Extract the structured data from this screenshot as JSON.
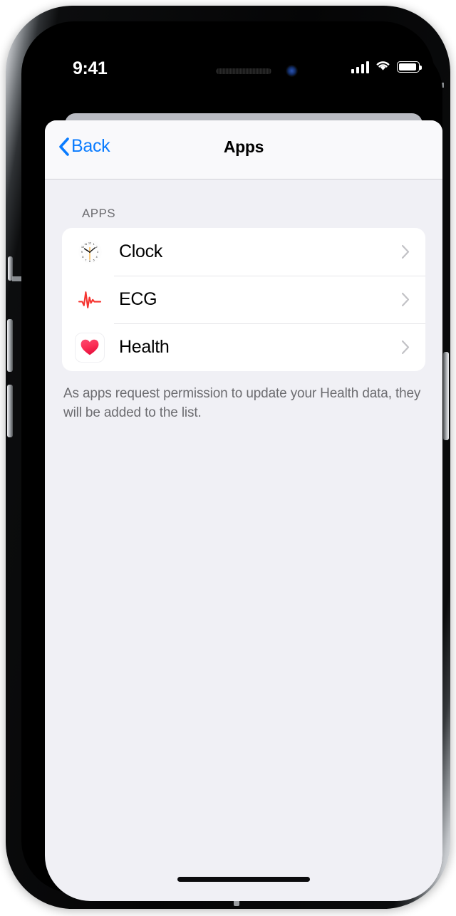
{
  "device": {
    "status_bar": {
      "time": "9:41",
      "signal_icon": "cellular-signal-icon",
      "signal_bars": 4,
      "wifi_icon": "wifi-icon",
      "battery_icon": "battery-icon",
      "battery_level": 100
    },
    "notch": {
      "speaker_icon": "speaker-grille-icon",
      "camera_icon": "front-camera-icon"
    },
    "home_indicator": "home-indicator"
  },
  "nav": {
    "back_label": "Back",
    "back_icon": "chevron-left-icon",
    "title": "Apps"
  },
  "content": {
    "section_header": "APPS",
    "apps": [
      {
        "label": "Clock",
        "icon": "clock-app-icon",
        "chevron": "chevron-right-icon"
      },
      {
        "label": "ECG",
        "icon": "ecg-app-icon",
        "chevron": "chevron-right-icon"
      },
      {
        "label": "Health",
        "icon": "health-app-icon",
        "chevron": "chevron-right-icon"
      }
    ],
    "footer_note": "As apps request permission to update your Health data, they will be added to the list."
  },
  "colors": {
    "accent_blue": "#0a7cff",
    "background": "#f0f0f5",
    "card": "#ffffff",
    "nav_bar": "#f9f9fb",
    "separator": "#e6e6e9",
    "secondary_text": "#6c6c70",
    "ecg_red": "#f5332f",
    "health_pink": "#fc2d55",
    "clock_orange": "#f5a623"
  }
}
